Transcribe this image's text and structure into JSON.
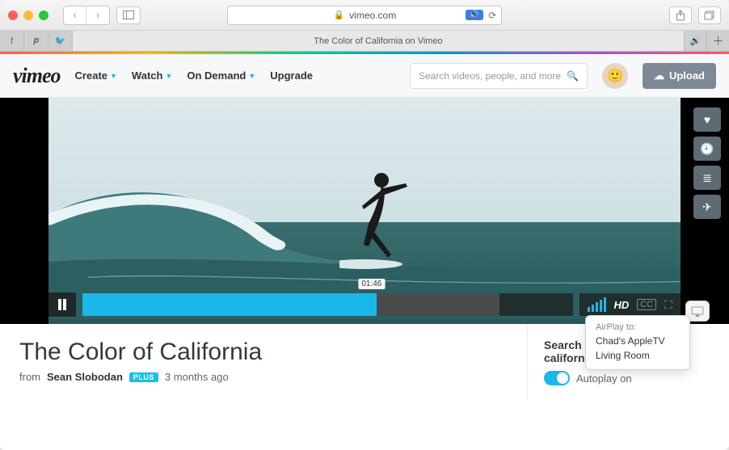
{
  "browser": {
    "url_host": "vimeo.com",
    "tab_title": "The Color of California on Vimeo"
  },
  "nav": {
    "logo": "vimeo",
    "items": [
      "Create",
      "Watch",
      "On Demand",
      "Upgrade"
    ],
    "search_placeholder": "Search videos, people, and more",
    "upload_label": "Upload"
  },
  "player": {
    "current_time": "01:46",
    "progress_pct": 60,
    "buffer_pct": 85,
    "hd_label": "HD"
  },
  "video": {
    "title": "The Color of California",
    "from_label": "from",
    "author": "Sean Slobodan",
    "badge": "PLUS",
    "age": "3 months ago"
  },
  "sidebar": {
    "results_label": "Search results for \"color of california\"",
    "autoplay_label": "Autoplay on"
  },
  "airplay": {
    "header": "AirPlay to:",
    "devices": [
      "Chad's AppleTV",
      "Living Room"
    ]
  }
}
